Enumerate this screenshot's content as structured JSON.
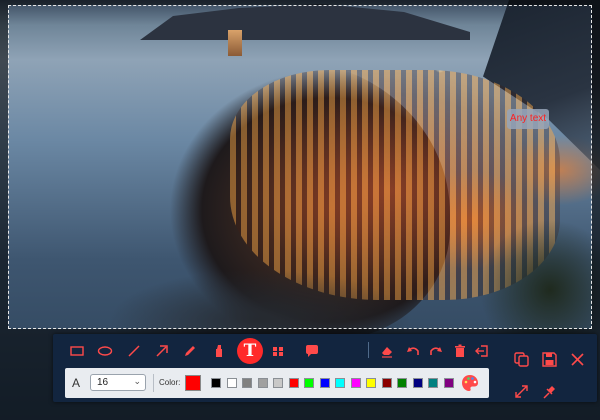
{
  "photo": {
    "description_icon": "coastal-village-photo"
  },
  "annotation": {
    "text": "Any text",
    "color": "#ff2020"
  },
  "toolbar": {
    "tools": [
      {
        "name": "rectangle-icon",
        "label": ""
      },
      {
        "name": "ellipse-icon",
        "label": ""
      },
      {
        "name": "line-icon",
        "label": ""
      },
      {
        "name": "arrow-icon",
        "label": ""
      },
      {
        "name": "pencil-icon",
        "label": ""
      },
      {
        "name": "highlighter-icon",
        "label": ""
      },
      {
        "name": "text-icon",
        "label": "T"
      },
      {
        "name": "mosaic-icon",
        "label": ""
      },
      {
        "name": "callout-icon",
        "label": ""
      },
      {
        "name": "eraser-icon",
        "label": ""
      },
      {
        "name": "undo-icon",
        "label": ""
      },
      {
        "name": "redo-icon",
        "label": ""
      },
      {
        "name": "delete-icon",
        "label": ""
      },
      {
        "name": "exit-icon",
        "label": ""
      }
    ],
    "text_tool_label": "T",
    "accent": "#ff2a2a"
  },
  "options": {
    "font_label": "A",
    "font_size": "16",
    "color_label": "Color:",
    "current_color": "#ff0000",
    "swatches": [
      "#000000",
      "#ffffff",
      "#808080",
      "#a0a0a0",
      "#c8c8c8",
      "#ff0000",
      "#00ff00",
      "#0000ff",
      "#00ffff",
      "#ff00ff",
      "#ffff00",
      "#8b0000",
      "#008000",
      "#000080",
      "#008080",
      "#800080"
    ]
  },
  "side_actions": [
    {
      "name": "copy-icon"
    },
    {
      "name": "save-icon"
    },
    {
      "name": "close-icon"
    },
    {
      "name": "expand-icon"
    },
    {
      "name": "pin-icon"
    }
  ]
}
